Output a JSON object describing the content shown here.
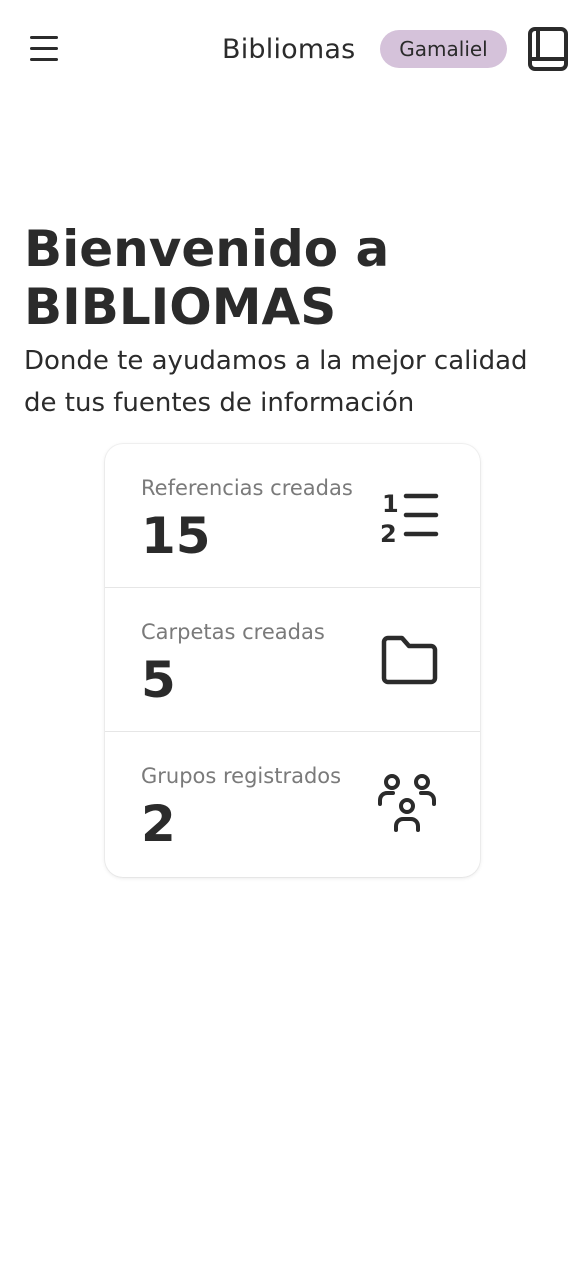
{
  "header": {
    "menu_icon": "hamburger-menu-icon",
    "brand": "Bibliomas",
    "user_name": "Gamaliel",
    "book_icon": "book-icon"
  },
  "hero": {
    "title": "Bienvenido a BIBLIOMAS",
    "subtitle": "Donde te ayudamos a la mejor calidad de tus fuentes de información"
  },
  "stats": [
    {
      "label": "Referencias creadas",
      "value": "15",
      "icon": "numbered-list-icon"
    },
    {
      "label": "Carpetas creadas",
      "value": "5",
      "icon": "folder-icon"
    },
    {
      "label": "Grupos registrados",
      "value": "2",
      "icon": "users-group-icon"
    }
  ]
}
